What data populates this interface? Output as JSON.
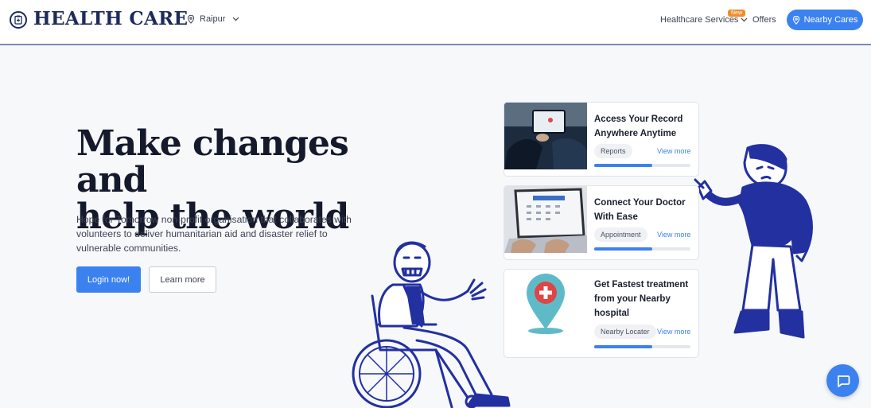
{
  "header": {
    "brand": "HEALTH CARE",
    "location": "Raipur",
    "nav_services": "Healthcare Services",
    "badge_new": "New",
    "nav_offers": "Offers",
    "nearby_button": "Nearby Cares"
  },
  "hero": {
    "title_line1": "Make changes and",
    "title_line2": "help the world",
    "description": "Hope for Tomorrow non-profit organisation that collaborates with volunteers to deliver humanitarian aid and disaster relief to vulnerable communities.",
    "login_button": "Login now!",
    "learn_button": "Learn more"
  },
  "cards": [
    {
      "title": "Access Your Record Anywhere Anytime",
      "tag": "Reports",
      "link": "View more",
      "progress": 0.6
    },
    {
      "title": "Connect Your Doctor With Ease",
      "tag": "Appointment",
      "link": "View more",
      "progress": 0.6
    },
    {
      "title": "Get Fastest treatment from your Nearby hospital",
      "tag": "Nearby Locater",
      "link": "View more",
      "progress": 0.6
    }
  ],
  "colors": {
    "accent": "#3b82f0",
    "brand": "#1e2a5a",
    "badge": "#f08c2a",
    "illustration": "#2230a0"
  },
  "icons": {
    "logo": "clipboard-medical-icon",
    "location": "map-pin-icon",
    "chevron": "chevron-down-icon",
    "chat": "chat-icon"
  }
}
